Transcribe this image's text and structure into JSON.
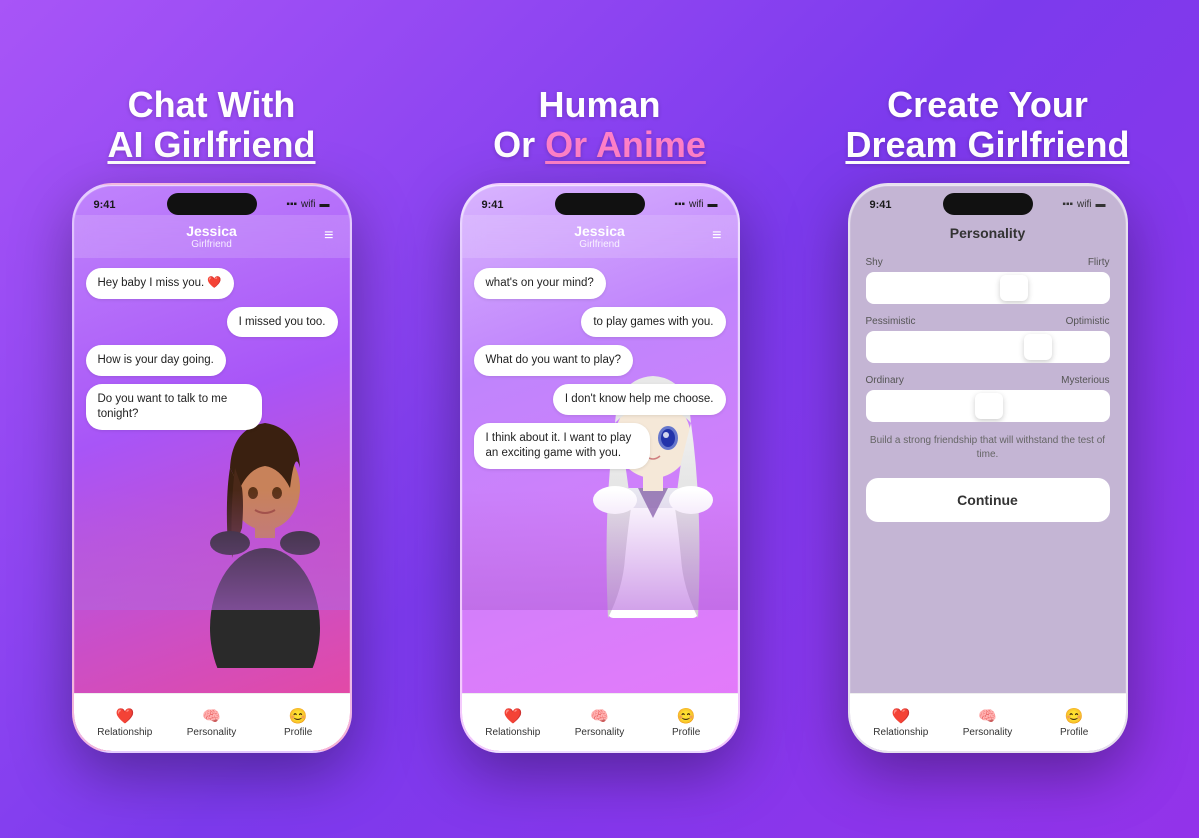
{
  "screen1": {
    "headline_line1": "Chat With",
    "headline_line2": "AI Girlfriend",
    "phone": {
      "status_time": "9:41",
      "char_name": "Jessica",
      "char_role": "Girlfriend",
      "messages": [
        {
          "text": "Hey baby I miss you. ❤️",
          "side": "left"
        },
        {
          "text": "I missed you too.",
          "side": "right"
        },
        {
          "text": "How is your day going.",
          "side": "left"
        },
        {
          "text": "Do you want to talk to me tonight?",
          "side": "left"
        }
      ],
      "tabs": [
        {
          "icon": "❤️",
          "label": "Relationship"
        },
        {
          "icon": "🧠",
          "label": "Personality"
        },
        {
          "icon": "😊",
          "label": "Profile"
        }
      ]
    }
  },
  "screen2": {
    "headline_line1": "Human",
    "headline_line2": "Or Anime",
    "phone": {
      "status_time": "9:41",
      "char_name": "Jessica",
      "char_role": "Girlfriend",
      "messages": [
        {
          "text": "what's on your mind?",
          "side": "left"
        },
        {
          "text": "to play games with you.",
          "side": "right"
        },
        {
          "text": "What do you want to play?",
          "side": "left"
        },
        {
          "text": "I don't know help me choose.",
          "side": "right"
        },
        {
          "text": "I think about it. I want to play an exciting game with you.",
          "side": "left"
        }
      ],
      "tabs": [
        {
          "icon": "❤️",
          "label": "Relationship"
        },
        {
          "icon": "🧠",
          "label": "Personality"
        },
        {
          "icon": "😊",
          "label": "Profile"
        }
      ]
    }
  },
  "screen3": {
    "headline_line1": "Create Your",
    "headline_line2": "Dream Girlfriend",
    "phone": {
      "status_time": "9:41",
      "personality_title": "Personality",
      "sliders": [
        {
          "left": "Shy",
          "right": "Flirty",
          "value": 65
        },
        {
          "left": "Pessimistic",
          "right": "Optimistic",
          "value": 75
        },
        {
          "left": "Ordinary",
          "right": "Mysterious",
          "value": 55
        }
      ],
      "description": "Build a strong friendship that will withstand the test of time.",
      "continue_label": "Continue",
      "tabs": [
        {
          "icon": "❤️",
          "label": "Relationship"
        },
        {
          "icon": "🧠",
          "label": "Personality"
        },
        {
          "icon": "😊",
          "label": "Profile"
        }
      ]
    }
  }
}
